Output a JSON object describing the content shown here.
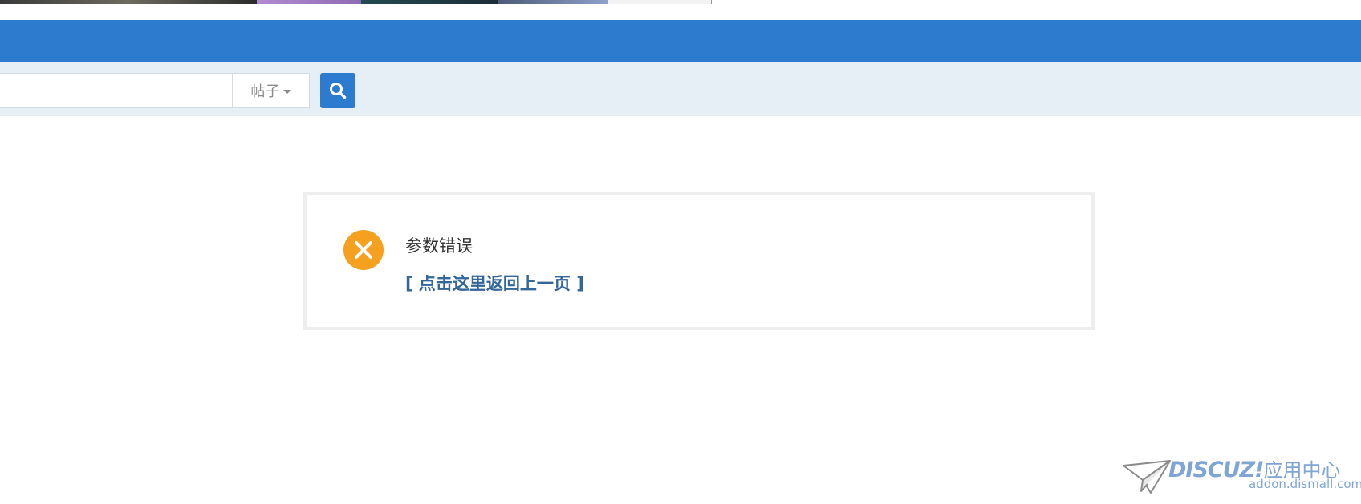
{
  "search": {
    "input_value": "",
    "type_label": "帖子"
  },
  "alert": {
    "message": "参数错误",
    "back_link": "[ 点击这里返回上一页 ]"
  },
  "watermark": {
    "brand": "DISCUZ!",
    "brand_cn": "应用中心",
    "url": "addon.dismall.com"
  },
  "icons": {
    "search": "search-icon",
    "error": "close-circle-icon",
    "caret": "caret-down-icon",
    "plane": "paper-plane-icon"
  },
  "colors": {
    "nav": "#2d7bcf",
    "search_bar": "#e6eef6",
    "error_icon": "#f5a01f",
    "link": "#336699",
    "watermark": "#7fa5d6"
  }
}
